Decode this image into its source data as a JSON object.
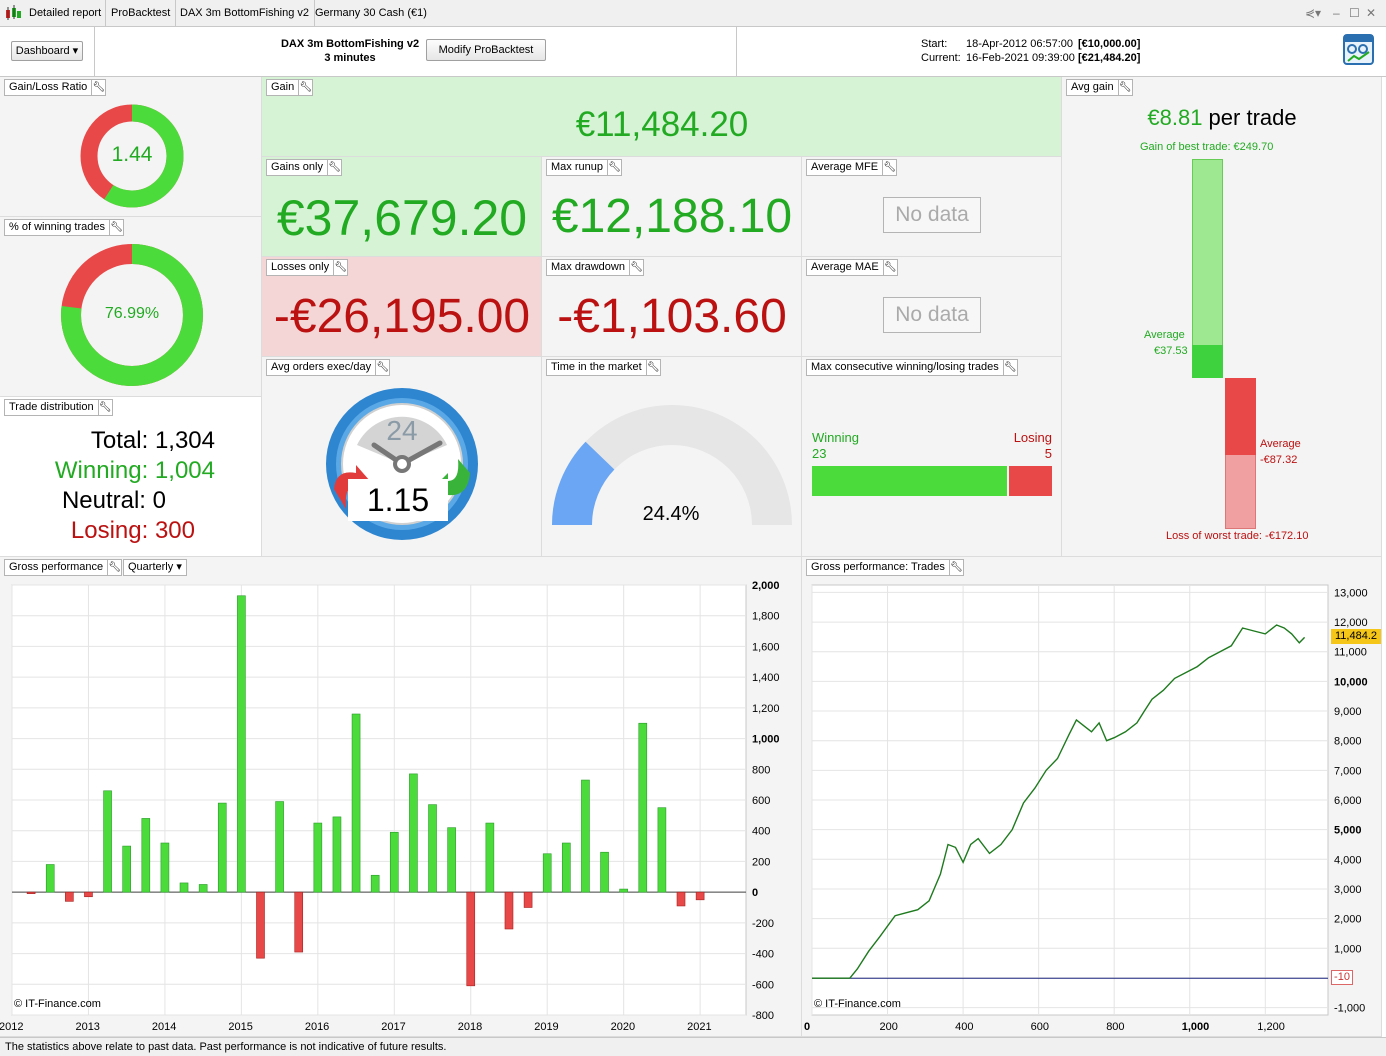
{
  "titlebar": {
    "tabs": [
      "Detailed report",
      "ProBacktest",
      "DAX 3m BottomFishing v2",
      "Germany 30 Cash (€1)"
    ]
  },
  "header": {
    "dashboard_label": "Dashboard",
    "system_name": "DAX 3m BottomFishing v2",
    "timeframe": "3 minutes",
    "modify_label": "Modify ProBacktest",
    "start_label": "Start:",
    "start_date": "18-Apr-2012 06:57:00",
    "start_capital": "[€10,000.00]",
    "current_label": "Current:",
    "current_date": "16-Feb-2021 09:39:00",
    "current_capital": "[€21,484.20]"
  },
  "gain_loss_ratio": {
    "label": "Gain/Loss Ratio",
    "value": "1.44",
    "win_fraction": 0.59
  },
  "winning_pct": {
    "label": "% of winning trades",
    "value": "76.99%",
    "win_fraction": 0.7699
  },
  "trade_distribution": {
    "label": "Trade distribution",
    "total": "Total: 1,304",
    "winning": "Winning: 1,004",
    "neutral": "Neutral: 0",
    "losing": "Losing: 300"
  },
  "gain": {
    "label": "Gain",
    "value": "€11,484.20"
  },
  "gains_only": {
    "label": "Gains only",
    "value": "€37,679.20"
  },
  "losses_only": {
    "label": "Losses only",
    "value": "-€26,195.00"
  },
  "max_runup": {
    "label": "Max runup",
    "value": "€12,188.10"
  },
  "max_drawdown": {
    "label": "Max drawdown",
    "value": "-€1,103.60"
  },
  "avg_mfe": {
    "label": "Average MFE",
    "value": "No data"
  },
  "avg_mae": {
    "label": "Average MAE",
    "value": "No data"
  },
  "avg_orders": {
    "label": "Avg orders exec/day",
    "clock": "24",
    "value": "1.15"
  },
  "time_in_market": {
    "label": "Time in the market",
    "value": "24.4%",
    "fraction": 0.244
  },
  "max_consecutive": {
    "label": "Max consecutive winning/losing trades",
    "winning_label": "Winning",
    "winning_value": "23",
    "losing_label": "Losing",
    "losing_value": "5",
    "win_count": 23,
    "lose_count": 5
  },
  "avg_gain": {
    "label": "Avg gain",
    "value": "€8.81",
    "suffix": " per trade",
    "best_trade": "Gain of best trade: €249.70",
    "avg_win_label": "Average",
    "avg_win_value": "€37.53",
    "avg_loss_label": "Average",
    "avg_loss_value": "-€87.32",
    "worst_trade": "Loss of worst trade: -€172.10",
    "best": 249.7,
    "avg_win": 37.53,
    "avg_loss": -87.32,
    "worst": -172.1
  },
  "gross_perf": {
    "label": "Gross performance",
    "period": "Quarterly",
    "copyright": "© IT-Finance.com"
  },
  "gross_trades": {
    "label": "Gross performance: Trades",
    "copyright": "© IT-Finance.com",
    "last_value": "11,484.2",
    "baseline_value": "-10"
  },
  "chart_data": [
    {
      "type": "bar",
      "title": "Gross performance",
      "x_ticks": [
        "2012",
        "2013",
        "2014",
        "2015",
        "2016",
        "2017",
        "2018",
        "2019",
        "2020",
        "2021"
      ],
      "y_ticks": [
        "2,000",
        "1,800",
        "1,600",
        "1,400",
        "1,200",
        "1,000",
        "800",
        "600",
        "400",
        "200",
        "0",
        "-200",
        "-400",
        "-600",
        "-800"
      ],
      "ylim": [
        -800,
        2000
      ],
      "xlim": [
        2012.0,
        2021.6
      ],
      "x": [
        2012.25,
        2012.5,
        2012.75,
        2013.0,
        2013.25,
        2013.5,
        2013.75,
        2014.0,
        2014.25,
        2014.5,
        2014.75,
        2015.0,
        2015.25,
        2015.5,
        2015.75,
        2016.0,
        2016.25,
        2016.5,
        2016.75,
        2017.0,
        2017.25,
        2017.5,
        2017.75,
        2018.0,
        2018.25,
        2018.5,
        2018.75,
        2019.0,
        2019.25,
        2019.5,
        2019.75,
        2020.0,
        2020.25,
        2020.5,
        2020.75,
        2021.0
      ],
      "values": [
        -10,
        180,
        -60,
        -30,
        660,
        300,
        480,
        320,
        60,
        50,
        580,
        1930,
        -430,
        590,
        -390,
        450,
        490,
        1160,
        110,
        390,
        770,
        570,
        420,
        -610,
        450,
        -240,
        -100,
        250,
        320,
        730,
        260,
        20,
        1100,
        550,
        -90,
        -50
      ]
    },
    {
      "type": "line",
      "title": "Gross performance: Trades",
      "x_ticks": [
        "0",
        "200",
        "400",
        "600",
        "800",
        "1,000",
        "1,200"
      ],
      "y_ticks": [
        "13,000",
        "12,000",
        "11,000",
        "10,000",
        "9,000",
        "8,000",
        "7,000",
        "6,000",
        "5,000",
        "4,000",
        "3,000",
        "2,000",
        "1,000",
        "0",
        "-1,000"
      ],
      "xlim": [
        0,
        1366
      ],
      "ylim": [
        -1250,
        13250
      ],
      "x": [
        0,
        60,
        100,
        120,
        150,
        180,
        220,
        250,
        280,
        310,
        340,
        360,
        380,
        400,
        420,
        440,
        470,
        500,
        530,
        560,
        590,
        620,
        650,
        680,
        700,
        720,
        740,
        760,
        780,
        800,
        830,
        860,
        880,
        900,
        930,
        960,
        990,
        1020,
        1050,
        1080,
        1110,
        1140,
        1170,
        1200,
        1230,
        1250,
        1270,
        1290,
        1304
      ],
      "y": [
        -10,
        -10,
        -10,
        300,
        900,
        1400,
        2100,
        2200,
        2300,
        2600,
        3500,
        4500,
        4400,
        3900,
        4500,
        4700,
        4200,
        4500,
        5000,
        5900,
        6400,
        7000,
        7400,
        8200,
        8700,
        8500,
        8300,
        8600,
        8000,
        8100,
        8300,
        8600,
        9000,
        9400,
        9700,
        10100,
        10300,
        10500,
        10800,
        11000,
        11200,
        11800,
        11700,
        11600,
        11900,
        11800,
        11600,
        11300,
        11484.2
      ]
    }
  ]
}
